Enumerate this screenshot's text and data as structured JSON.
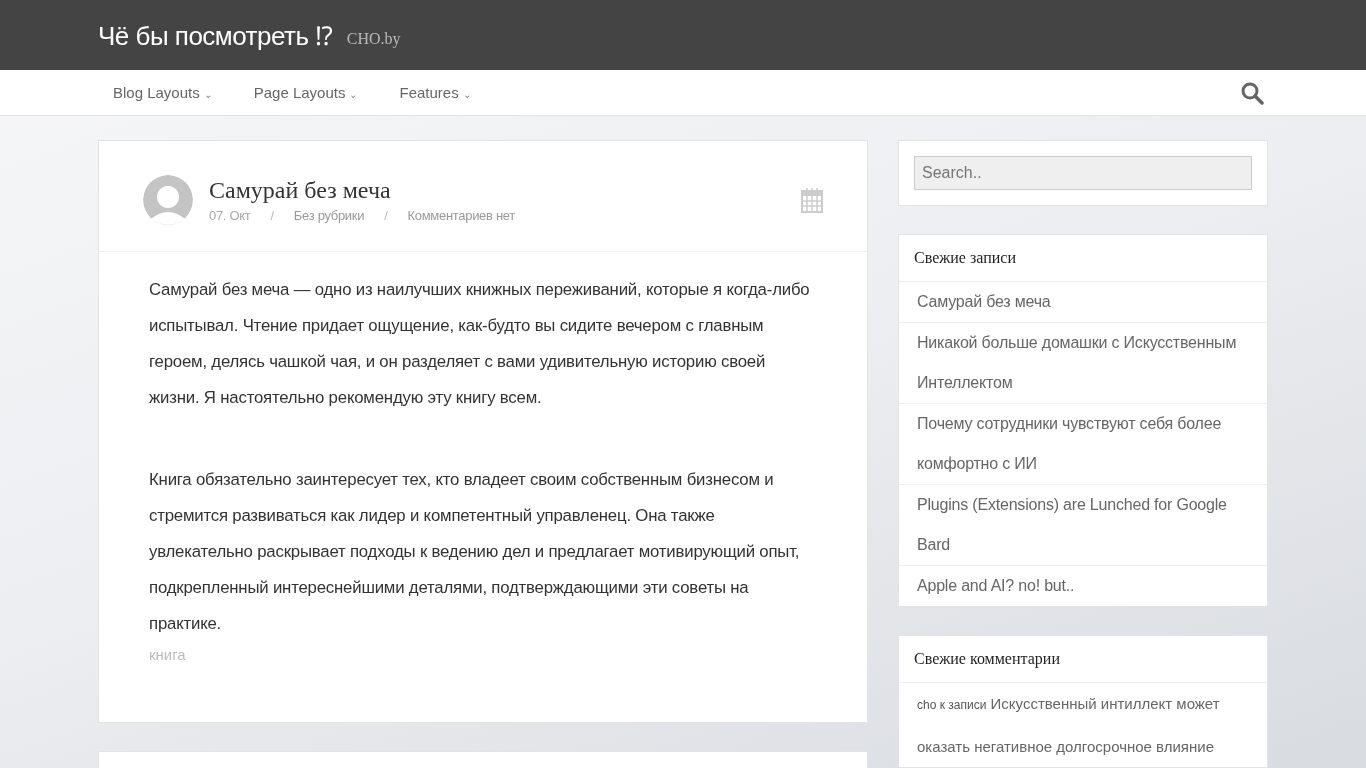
{
  "site": {
    "title": "Чё бы посмотреть ⁉",
    "tagline": "CHO.by"
  },
  "nav": [
    {
      "label": "Blog Layouts",
      "caret": "⌄"
    },
    {
      "label": "Page Layouts",
      "caret": "⌄"
    },
    {
      "label": "Features",
      "caret": "⌄"
    }
  ],
  "post": {
    "title": "Самурай без меча",
    "meta": [
      {
        "text": "07. Окт",
        "kind": "date"
      },
      {
        "text": "/",
        "kind": "sep"
      },
      {
        "text": "Без рубрики",
        "kind": "link"
      },
      {
        "text": "/",
        "kind": "sep"
      },
      {
        "text": "Комментариев нет",
        "kind": "link"
      }
    ],
    "paragraphs": [
      "Самурай без меча — одно из наилучших книжных переживаний, которые я когда-либо испытывал. Чтение придает ощущение, как-будто вы сидите вечером с главным героем, делясь чашкой чая, и он разделяет с вами удивительную историю своей жизни. Я настоятельно рекомендую эту книгу всем.",
      "Книга обязательно заинтересует тех, кто владеет своим собственным бизнесом и стремится развиваться как лидер и компетентный управленец. Она также увлекательно раскрывает подходы к ведению дел и предлагает мотивирующий опыт, подкрепленный интереснейшими деталями, подтверждающими эти советы на практике."
    ],
    "tag": "книга"
  },
  "search": {
    "placeholder": "Search.."
  },
  "recent_posts": {
    "title": "Свежие записи",
    "items": [
      "Самурай без меча",
      "Никакой больше домашки с Искусственным Интеллектом",
      "Почему сотрудники чувствуют себя более комфортно с ИИ",
      "Plugins (Extensions) are Lunched for Google Bard",
      "Apple and AI? no! but.."
    ]
  },
  "recent_comments": {
    "title": "Свежие комментарии",
    "items": [
      {
        "author": "cho",
        "prefix": "к записи",
        "post": "Искусственный интиллект может оказать негативное долгосрочное влияние"
      }
    ]
  }
}
